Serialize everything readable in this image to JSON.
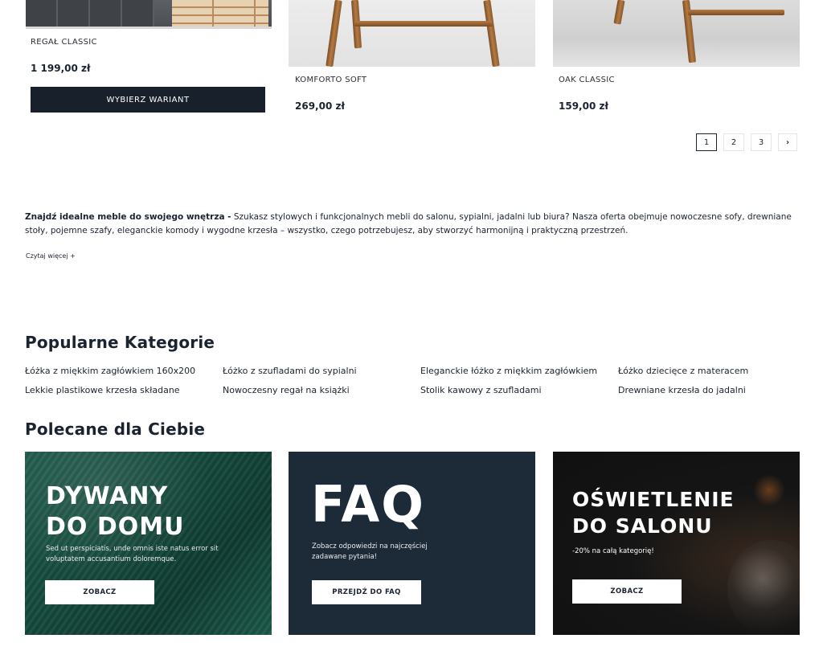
{
  "products": [
    {
      "name": "REGAŁ CLASSIC",
      "price": "1 199,00 zł",
      "button": "WYBIERZ WARIANT"
    },
    {
      "name": "KOMFORTO SOFT",
      "price": "269,00 zł"
    },
    {
      "name": "OAK CLASSIC",
      "price": "159,00 zł"
    }
  ],
  "pagination": {
    "pages": [
      "1",
      "2",
      "3"
    ],
    "active": "1",
    "next": "›"
  },
  "seo": {
    "bold": "Znajdź idealne meble do swojego wnętrza -",
    "text": " Szukasz stylowych i funkcjonalnych mebli do salonu, sypialni, jadalni lub biura?  Nasza oferta obejmuje nowoczesne sofy, drewniane stoły, pojemne szafy, eleganckie komody i wygodne krzesła – wszystko, czego potrzebujesz, aby stworzyć harmonijną i praktyczną przestrzeń.",
    "read_more": "Czytaj więcej  +"
  },
  "popular": {
    "title": "Popularne Kategorie",
    "links": [
      "Łóżka z miękkim zagłówkiem 160x200",
      "Łóżko z szufladami do sypialni",
      "Eleganckie łóżko z miękkim zagłówkiem",
      "Łóżko dziecięce z materacem",
      "Lekkie plastikowe krzesła składane",
      "Nowoczesny regał na książki",
      "Stolik kawowy z szufladami",
      "Drewniane krzesła do jadalni"
    ]
  },
  "recommended": {
    "title": "Polecane dla Ciebie",
    "cards": [
      {
        "title_line1": "DYWANY",
        "title_line2": "DO DOMU",
        "desc": "Sed ut perspiciatis, unde omnis iste natus error sit voluptatem accusantium doloremque.",
        "button": "ZOBACZ",
        "bg": "#1d5a4a"
      },
      {
        "title_line1": "FAQ",
        "desc": "Zobacz odpowiedzi na najczęściej zadawane pytania!",
        "button": "PRZEJDŹ DO FAQ",
        "bg": "#1d2a38"
      },
      {
        "title_line1": "OŚWIETLENIE",
        "title_line2": "DO SALONU",
        "desc": "-20% na całą kategorię!",
        "button": "ZOBACZ",
        "bg": "#151515"
      }
    ]
  }
}
